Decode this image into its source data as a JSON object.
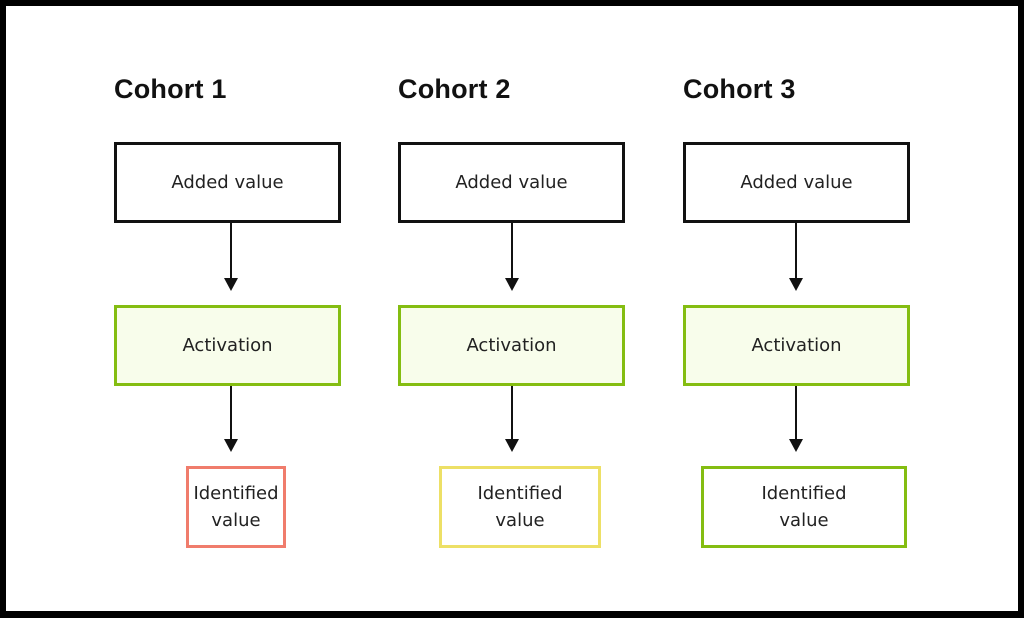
{
  "colors": {
    "frame": "#000000",
    "added_border": "#111111",
    "activation_border": "#84bd11",
    "activation_fill": "#f8fdeb",
    "identified_red": "#f07c6c",
    "identified_yellow": "#ede066",
    "identified_green": "#84bd11"
  },
  "cohorts": [
    {
      "title": "Cohort 1",
      "added": "Added value",
      "activation": "Activation",
      "identified_line1": "Identified",
      "identified_line2": "value",
      "identified_status": "red"
    },
    {
      "title": "Cohort 2",
      "added": "Added value",
      "activation": "Activation",
      "identified_line1": "Identified",
      "identified_line2": "value",
      "identified_status": "yellow"
    },
    {
      "title": "Cohort 3",
      "added": "Added value",
      "activation": "Activation",
      "identified_line1": "Identified",
      "identified_line2": "value",
      "identified_status": "green"
    }
  ]
}
